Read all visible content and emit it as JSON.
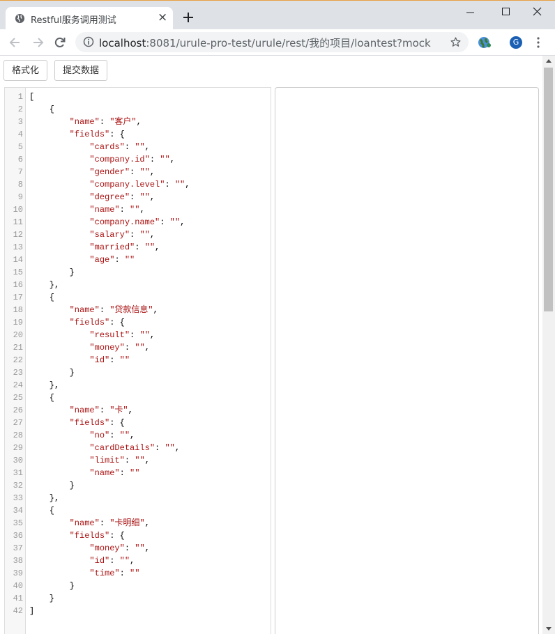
{
  "browser": {
    "tab_title": "Restful服务调用测试",
    "tab_close": "×",
    "url_host": "localhost",
    "url_rest": ":8081/urule-pro-test/urule/rest/我的项目/loantest?mock",
    "profile_initial": "G"
  },
  "toolbar": {
    "format_label": "格式化",
    "submit_label": "提交数据"
  },
  "editor": {
    "lines": [
      "[",
      "    {",
      "        \"name\": \"客户\",",
      "        \"fields\": {",
      "            \"cards\": \"\",",
      "            \"company.id\": \"\",",
      "            \"gender\": \"\",",
      "            \"company.level\": \"\",",
      "            \"degree\": \"\",",
      "            \"name\": \"\",",
      "            \"company.name\": \"\",",
      "            \"salary\": \"\",",
      "            \"married\": \"\",",
      "            \"age\": \"\"",
      "        }",
      "    },",
      "    {",
      "        \"name\": \"贷款信息\",",
      "        \"fields\": {",
      "            \"result\": \"\",",
      "            \"money\": \"\",",
      "            \"id\": \"\"",
      "        }",
      "    },",
      "    {",
      "        \"name\": \"卡\",",
      "        \"fields\": {",
      "            \"no\": \"\",",
      "            \"cardDetails\": \"\",",
      "            \"limit\": \"\",",
      "            \"name\": \"\"",
      "        }",
      "    },",
      "    {",
      "        \"name\": \"卡明细\",",
      "        \"fields\": {",
      "            \"money\": \"\",",
      "            \"id\": \"\",",
      "            \"time\": \"\"",
      "        }",
      "    }",
      "]"
    ]
  },
  "colors": {
    "string": "#aa1111",
    "gutter_bg": "#f7f7f7",
    "line_number": "#999999",
    "avatar": "#1a5fb4"
  }
}
